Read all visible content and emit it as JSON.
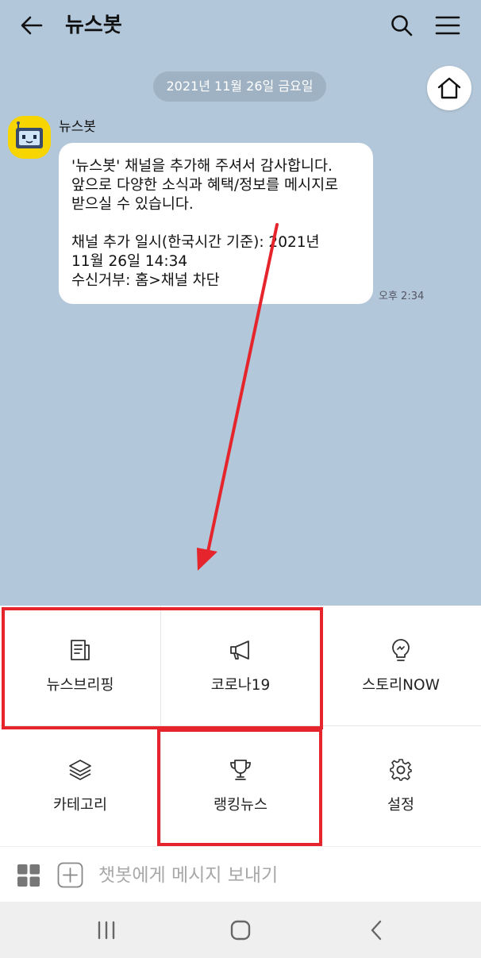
{
  "header": {
    "title": "뉴스봇",
    "back_icon": "arrow-left-icon",
    "search_icon": "search-icon",
    "menu_icon": "hamburger-icon"
  },
  "chat": {
    "date": "2021년 11월 26일 금요일",
    "home_icon": "home-icon",
    "message": {
      "sender": "뉴스봇",
      "text": "'뉴스봇' 채널을 추가해 주셔서 감사합니다.\n앞으로 다양한 소식과 혜택/정보를 메시지로\n받으실 수 있습니다.\n\n채널 추가 일시(한국시간 기준): 2021년\n11월 26일 14:34\n수신거부: 홈>채널 차단",
      "time": "오후 2:34"
    }
  },
  "menu": {
    "items": [
      {
        "label": "뉴스브리핑",
        "icon": "newspaper-icon"
      },
      {
        "label": "코로나19",
        "icon": "megaphone-icon"
      },
      {
        "label": "스토리NOW",
        "icon": "lightbulb-icon"
      },
      {
        "label": "카테고리",
        "icon": "layers-icon"
      },
      {
        "label": "랭킹뉴스",
        "icon": "trophy-icon"
      },
      {
        "label": "설정",
        "icon": "gear-icon"
      }
    ]
  },
  "input_bar": {
    "placeholder": "챗봇에게 메시지 보내기",
    "value": ""
  },
  "colors": {
    "chat_bg": "#b2c7d9",
    "bubble": "#ffffff",
    "avatar": "#f7d500",
    "annotation": "#e5242b"
  }
}
